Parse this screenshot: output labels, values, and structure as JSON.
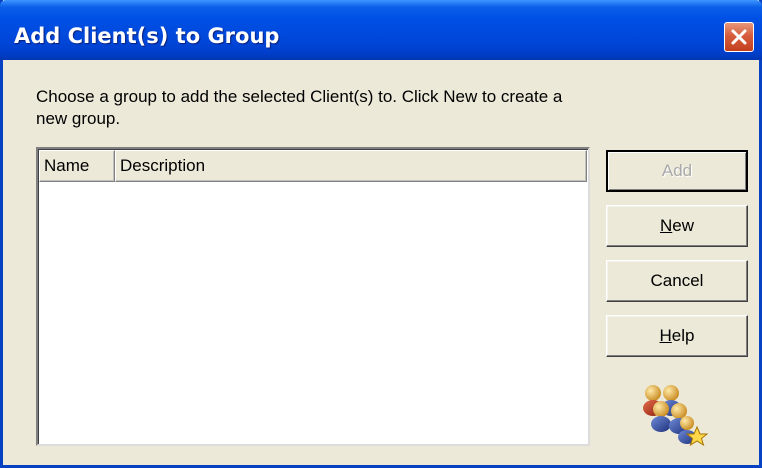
{
  "window": {
    "title": "Add Client(s) to Group"
  },
  "instructions": "Choose a group to add the selected Client(s) to.  Click New to create a new group.",
  "list": {
    "columns": [
      "Name",
      "Description"
    ],
    "rows": []
  },
  "buttons": {
    "add": {
      "label": "Add",
      "enabled": false
    },
    "new": {
      "label_prefix": "",
      "mnemonic": "N",
      "label_suffix": "ew"
    },
    "cancel": {
      "label": "Cancel"
    },
    "help": {
      "label_prefix": "",
      "mnemonic": "H",
      "label_suffix": "elp"
    }
  },
  "icons": {
    "close": "close-icon",
    "group": "client-group-icon"
  },
  "colors": {
    "titlebar": "#0046D8",
    "dialog_bg": "#ECE9D8",
    "close_button": "#D65D3D"
  }
}
